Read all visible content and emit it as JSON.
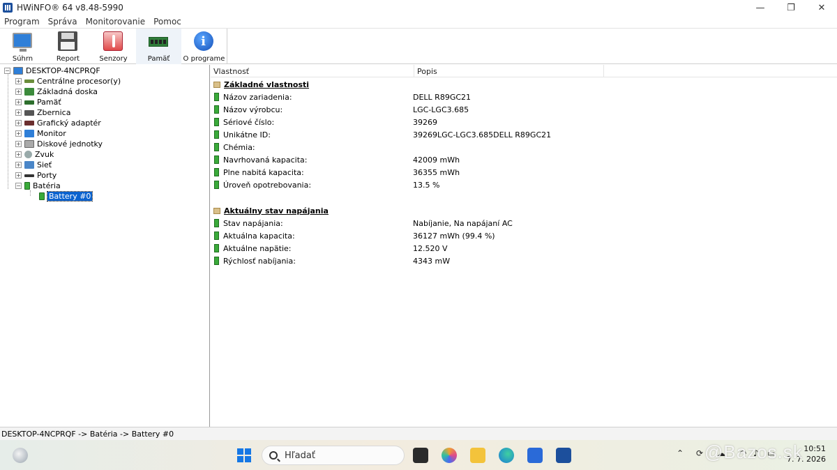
{
  "window": {
    "title": "HWiNFO® 64 v8.48-5990",
    "minimize_glyph": "—",
    "maximize_glyph": "❐",
    "close_glyph": "✕"
  },
  "menu": [
    "Program",
    "Správa",
    "Monitorovanie",
    "Pomoc"
  ],
  "toolbar": {
    "buttons": [
      {
        "label": "Súhrn",
        "icon": "monitor-icon"
      },
      {
        "label": "Report",
        "icon": "floppy-icon"
      },
      {
        "label": "Senzory",
        "icon": "thermometer-icon"
      },
      {
        "label": "Pamäť",
        "icon": "ram-icon",
        "active": true
      },
      {
        "label": "O programe",
        "icon": "info-icon"
      }
    ]
  },
  "tree": {
    "root": "DESKTOP-4NCPRQF",
    "items": [
      "Centrálne procesor(y)",
      "Základná doska",
      "Pamäť",
      "Zbernica",
      "Grafický adaptér",
      "Monitor",
      "Diskové jednotky",
      "Zvuk",
      "Sieť",
      "Porty",
      "Batéria"
    ],
    "selected_child": "Battery #0"
  },
  "list": {
    "columns": [
      "Vlastnosť",
      "Popis"
    ],
    "groups": [
      {
        "title": "Základné vlastnosti",
        "rows": [
          {
            "name": "Názov zariadenia:",
            "value": "DELL R89GC21"
          },
          {
            "name": "Názov výrobcu:",
            "value": "LGC-LGC3.685"
          },
          {
            "name": "Sériové číslo:",
            "value": "39269"
          },
          {
            "name": "Unikátne ID:",
            "value": "39269LGC-LGC3.685DELL R89GC21"
          },
          {
            "name": "Chémia:",
            "value": ""
          },
          {
            "name": "Navrhovaná kapacita:",
            "value": "42009 mWh"
          },
          {
            "name": "Plne nabitá kapacita:",
            "value": "36355 mWh"
          },
          {
            "name": "Úroveň opotrebovania:",
            "value": "13.5 %"
          }
        ]
      },
      {
        "title": "Aktuálny stav napájania",
        "rows": [
          {
            "name": "Stav napájania:",
            "value": "Nabíjanie, Na napájaní AC"
          },
          {
            "name": "Aktuálna kapacita:",
            "value": "36127 mWh (99.4 %)"
          },
          {
            "name": "Aktuálne napätie:",
            "value": "12.520 V"
          },
          {
            "name": "Rýchlosť nabíjania:",
            "value": "4343 mW"
          }
        ]
      }
    ]
  },
  "statusbar": {
    "path": "DESKTOP-4NCPRQF -> Batéria -> Battery #0"
  },
  "taskbar": {
    "search_placeholder": "Hľadať",
    "time": "10:51",
    "date": "7. 7. 2026"
  },
  "watermark": "@Bazos.sk",
  "colors": {
    "selection": "#0b63cf",
    "battery_green": "#3aaa3a"
  }
}
